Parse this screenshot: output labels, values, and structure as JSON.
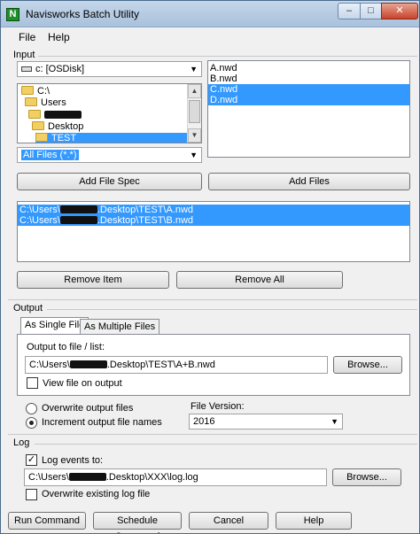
{
  "window": {
    "title": "Navisworks Batch Utility",
    "icon_letter": "N",
    "controls": {
      "minimize": "–",
      "maximize": "□",
      "close": "✕"
    }
  },
  "menu": [
    "File",
    "Help"
  ],
  "input": {
    "label": "Input",
    "drive": "c: [OSDisk]",
    "tree": [
      {
        "label": "C:\\",
        "redacted": false
      },
      {
        "label": "Users",
        "redacted": false
      },
      {
        "label": "",
        "redacted": true
      },
      {
        "label": "Desktop",
        "redacted": false
      },
      {
        "label": "TEST",
        "redacted": false
      }
    ],
    "files": [
      "A.nwd",
      "B.nwd",
      "C.nwd",
      "D.nwd"
    ],
    "selected_files": [
      "C.nwd",
      "D.nwd"
    ],
    "filter": "All Files (*.*)",
    "add_file_spec": "Add File Spec",
    "add_files": "Add Files",
    "queue": [
      {
        "prefix": "C:\\Users\\",
        "suffix": ".Desktop\\TEST\\A.nwd"
      },
      {
        "prefix": "C:\\Users\\",
        "suffix": ".Desktop\\TEST\\B.nwd"
      }
    ],
    "remove_item": "Remove Item",
    "remove_all": "Remove All"
  },
  "output": {
    "label": "Output",
    "tabs": [
      "As Single File",
      "As Multiple Files"
    ],
    "output_to_label": "Output to file / list:",
    "output_path": {
      "prefix": "C:\\Users\\",
      "suffix": ".Desktop\\TEST\\A+B.nwd"
    },
    "browse": "Browse...",
    "view_file_label": "View file on output",
    "overwrite_label": "Overwrite output files",
    "increment_label": "Increment output file names",
    "file_version_label": "File Version:",
    "file_version": "2016"
  },
  "log": {
    "label": "Log",
    "log_events_label": "Log events to:",
    "log_path": {
      "prefix": "C:\\Users\\",
      "suffix": ".Desktop\\XXX\\log.log"
    },
    "browse": "Browse...",
    "overwrite_log_label": "Overwrite existing log file"
  },
  "footer": {
    "run": "Run Command",
    "schedule": "Schedule Command",
    "cancel": "Cancel",
    "help": "Help"
  }
}
